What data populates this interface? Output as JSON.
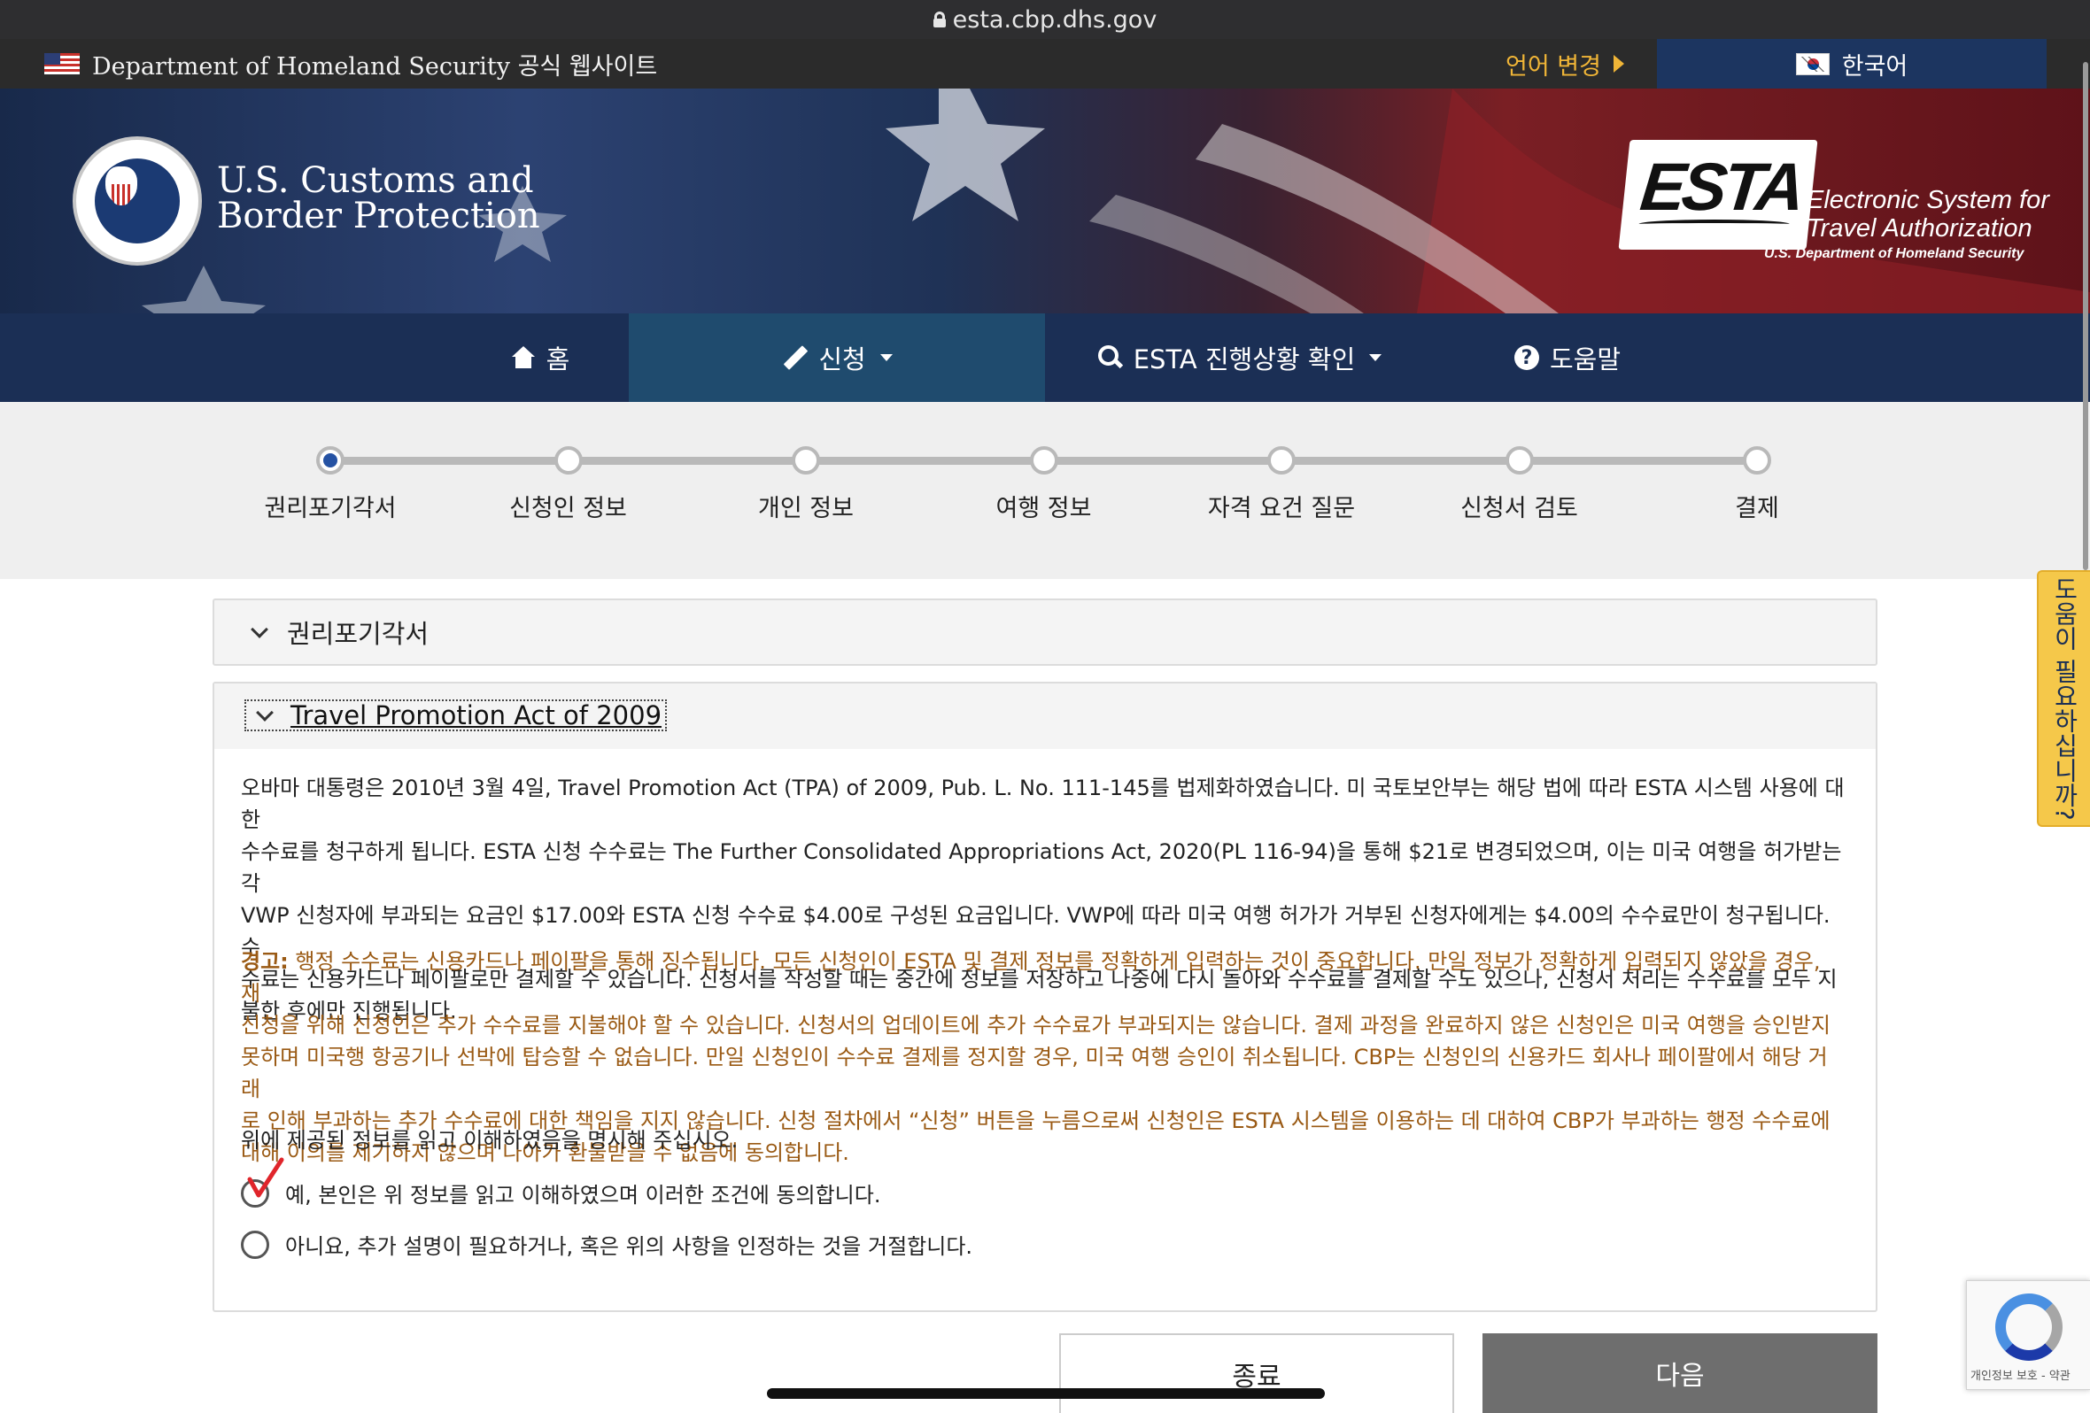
{
  "browser": {
    "url": "esta.cbp.dhs.gov"
  },
  "topbar": {
    "official_text": "Department of Homeland Security 공식 웹사이트",
    "language_change": "언어 변경",
    "current_language": "한국어"
  },
  "banner": {
    "agency_line1": "U.S. Customs and",
    "agency_line2": "Border Protection",
    "esta_logo": "ESTA",
    "esta_line1": "Electronic System for",
    "esta_line2": "Travel Authorization",
    "esta_dhs": "U.S. Department of Homeland Security"
  },
  "nav": {
    "home": "홈",
    "apply": "신청",
    "status": "ESTA 진행상황 확인",
    "help": "도움말"
  },
  "progress": {
    "steps": [
      "권리포기각서",
      "신청인 정보",
      "개인 정보",
      "여행 정보",
      "자격 요건 질문",
      "신청서 검토",
      "결제"
    ],
    "current_index": 0
  },
  "panels": {
    "waiver_title": "권리포기각서",
    "tpa_title": "Travel Promotion Act of 2009",
    "tpa_body_lines": [
      "오바마 대통령은 2010년 3월 4일, Travel Promotion Act (TPA) of 2009, Pub. L. No. 111-145를 법제화하였습니다. 미 국토보안부는 해당 법에 따라 ESTA 시스템 사용에 대한",
      "수수료를 청구하게 됩니다. ESTA 신청 수수료는 The Further Consolidated Appropriations Act, 2020(PL 116-94)을 통해 $21로 변경되었으며, 이는 미국 여행을 허가받는 각",
      "VWP 신청자에 부과되는 요금인 $17.00와 ESTA 신청 수수료 $4.00로 구성된 요금입니다. VWP에 따라 미국 여행 허가가 거부된 신청자에게는 $4.00의 수수료만이 청구됩니다. 수",
      "수료는 신용카드나 페이팔로만 결제할 수 있습니다. 신청서를 작성할 때는 중간에 정보를 저장하고 나중에 다시 돌아와 수수료를 결제할 수도 있으나, 신청서 처리는 수수료를 모두 지",
      "불한 후에만 진행됩니다."
    ],
    "warning_label": "경고:",
    "warning_lines": [
      " 행정 수수료는 신용카드나 페이팔을 통해 징수됩니다. 모든 신청인이 ESTA 및 결제 정보를 정확하게 입력하는 것이 중요합니다. 만일 정보가 정확하게 입력되지 않았을 경우, 재",
      "신청을 위해 신청인은 추가 수수료를 지불해야 할 수 있습니다. 신청서의 업데이트에 추가 수수료가 부과되지는 않습니다. 결제 과정을 완료하지 않은 신청인은 미국 여행을 승인받지",
      "못하며 미국행 항공기나 선박에 탑승할 수 없습니다. 만일 신청인이 수수료 결제를 정지할 경우, 미국 여행 승인이 취소됩니다. CBP는 신청인의 신용카드 회사나 페이팔에서 해당 거래",
      "로 인해 부과하는 추가 수수료에 대한 책임을 지지 않습니다. 신청 절차에서 “신청” 버튼을 누름으로써 신청인은 ESTA 시스템을 이용하는 데 대하여 CBP가 부과하는 행정 수수료에",
      "대해 이의를 제기하지 않으며 나아가 환불받을 수 없음에 동의합니다."
    ],
    "confirm_prompt": "위에 제공된 정보를 읽고 이해하였음을 명시해 주십시오.",
    "option_yes": "예, 본인은 위 정보를 읽고 이해하였으며 이러한 조건에 동의합니다.",
    "option_no": "아니요, 추가 설명이 필요하거나, 혹은 위의 사항을 인정하는 것을 거절합니다."
  },
  "buttons": {
    "exit": "종료",
    "next": "다음"
  },
  "side_help": "도움이 필요하십니까?",
  "recaptcha": {
    "text": "개인정보 보호 - 약관"
  },
  "colors": {
    "nav_bg": "#1b2f55",
    "nav_active": "#1f4b6e",
    "warning_text": "#9a5a14",
    "language_change": "#f0b537",
    "next_button": "#6e6e6e"
  }
}
